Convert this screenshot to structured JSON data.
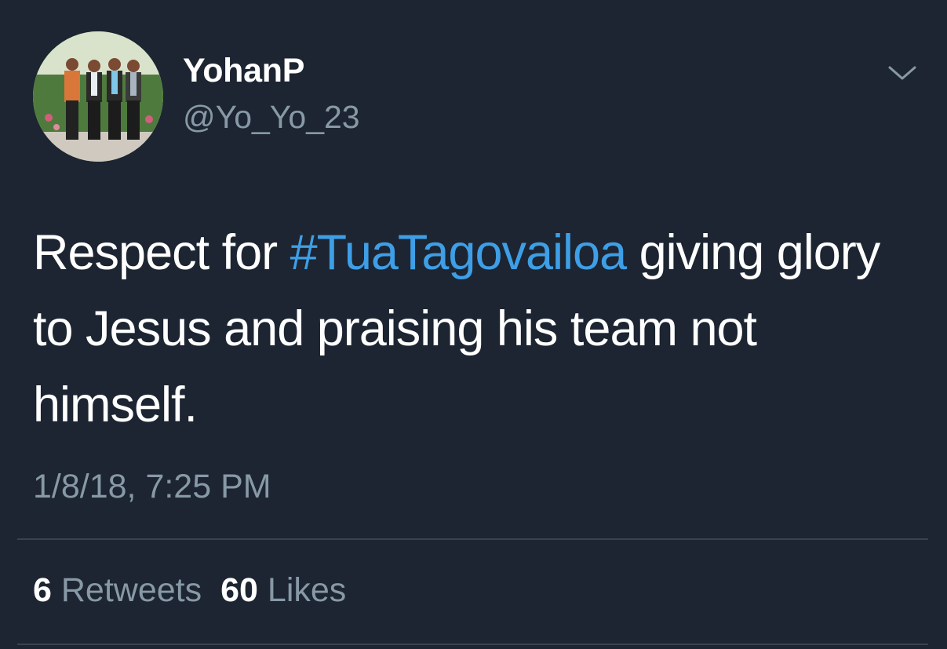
{
  "user": {
    "display_name": "YohanP",
    "handle": "@Yo_Yo_23"
  },
  "tweet": {
    "text_before": "Respect for ",
    "hashtag": "#TuaTagovailoa",
    "text_after": " giving glory to Jesus and praising his team not himself.",
    "timestamp": "1/8/18, 7:25 PM"
  },
  "stats": {
    "retweets_count": "6",
    "retweets_label": "Retweets",
    "likes_count": "60",
    "likes_label": "Likes"
  },
  "icons": {
    "menu": "chevron-down-icon"
  },
  "colors": {
    "background": "#1c2531",
    "text": "#ffffff",
    "secondary_text": "#8899a6",
    "link": "#3e9ee6",
    "divider": "#38444d"
  }
}
